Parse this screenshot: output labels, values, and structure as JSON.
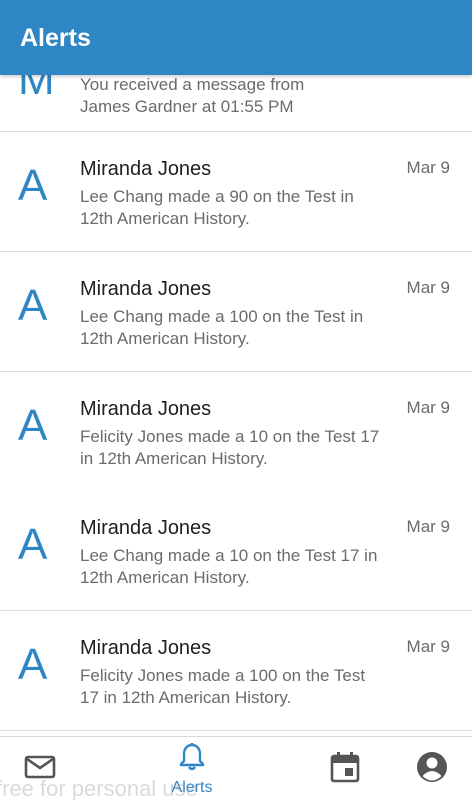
{
  "header": {
    "title": "Alerts"
  },
  "partial_item": {
    "letter": "M",
    "line1": "You received a message from",
    "line2": "James Gardner at 01:55 PM"
  },
  "alerts": [
    {
      "letter": "A",
      "title": "Miranda Jones",
      "message": "Lee Chang made a 90 on the Test in 12th American History.",
      "date": "Mar 9"
    },
    {
      "letter": "A",
      "title": "Miranda Jones",
      "message": "Lee Chang made a 100 on the Test in 12th American History.",
      "date": "Mar 9"
    },
    {
      "letter": "A",
      "title": "Miranda Jones",
      "message": "Felicity Jones made a 10 on the Test 17 in 12th American History.",
      "date": "Mar 9"
    },
    {
      "letter": "A",
      "title": "Miranda Jones",
      "message": "Lee Chang made a 10 on the Test 17 in 12th American History.",
      "date": "Mar 9"
    },
    {
      "letter": "A",
      "title": "Miranda Jones",
      "message": "Felicity Jones made a 100 on the Test 17 in 12th American History.",
      "date": "Mar 9"
    }
  ],
  "bottom_nav": {
    "items": [
      {
        "icon": "mail-icon",
        "label": ""
      },
      {
        "icon": "bell-icon",
        "label": "Alerts",
        "active": true
      },
      {
        "icon": "calendar-icon",
        "label": ""
      },
      {
        "icon": "account-icon",
        "label": ""
      }
    ]
  },
  "watermark": "free for personal use",
  "colors": {
    "accent": "#2f86c4",
    "text_secondary": "#6b6b6b",
    "divider": "#dcdcdc",
    "icon_gray": "#555555"
  }
}
